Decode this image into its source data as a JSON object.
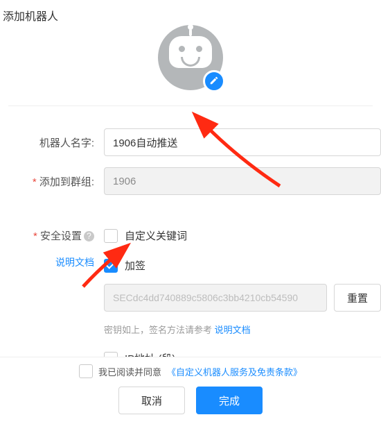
{
  "title": "添加机器人",
  "form": {
    "name_label": "机器人名字:",
    "name_value": "1906自动推送",
    "group_label": "添加到群组:",
    "group_value": "1906"
  },
  "security": {
    "title": "安全设置",
    "help_doc": "说明文档",
    "keyword_label": "自定义关键词",
    "keyword_checked": false,
    "sign_label": "加签",
    "sign_checked": true,
    "secret_value": "SECdc4dd740889c5806c3bb4210cb54590",
    "reset_btn": "重置",
    "hint_prefix": "密钥如上，签名方法请参考 ",
    "hint_link": "说明文档",
    "ip_label": "IP地址 (段)",
    "ip_checked": false
  },
  "footer": {
    "agree_prefix": "我已阅读并同意",
    "agree_link": "《自定义机器人服务及免责条款》",
    "cancel": "取消",
    "ok": "完成"
  }
}
